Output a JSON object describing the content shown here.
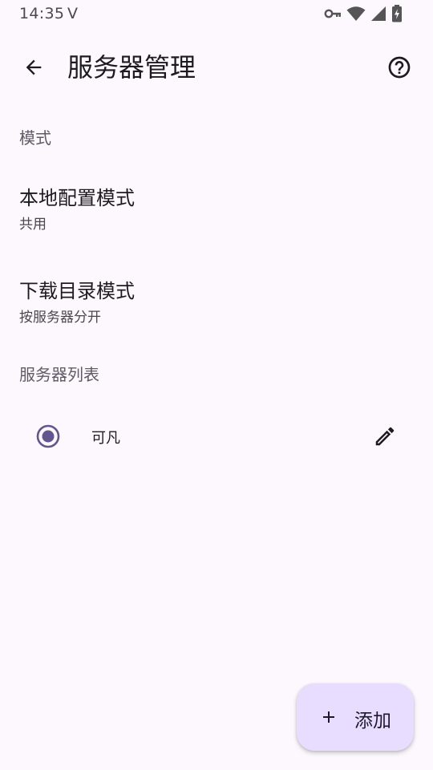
{
  "status_bar": {
    "time": "14:35",
    "carrier_icon": "V",
    "icons": [
      "vpn-key-icon",
      "wifi-icon",
      "cellular-signal-icon",
      "battery-charging-icon"
    ]
  },
  "app_bar": {
    "title": "服务器管理",
    "back_icon": "arrow-back-icon",
    "help_icon": "help-circle-icon"
  },
  "sections": {
    "mode": {
      "header": "模式",
      "items": [
        {
          "title": "本地配置模式",
          "summary": "共用"
        },
        {
          "title": "下载目录模式",
          "summary": "按服务器分开"
        }
      ]
    },
    "servers": {
      "header": "服务器列表",
      "list": [
        {
          "name": "可凡",
          "selected": true,
          "edit_icon": "pencil-icon"
        }
      ]
    }
  },
  "fab": {
    "label": "添加",
    "icon": "plus-icon"
  },
  "colors": {
    "background": "#fdf8fd",
    "accent": "#65558f",
    "fab_background": "#e9ddff",
    "secondary_text": "#5f5b66"
  }
}
